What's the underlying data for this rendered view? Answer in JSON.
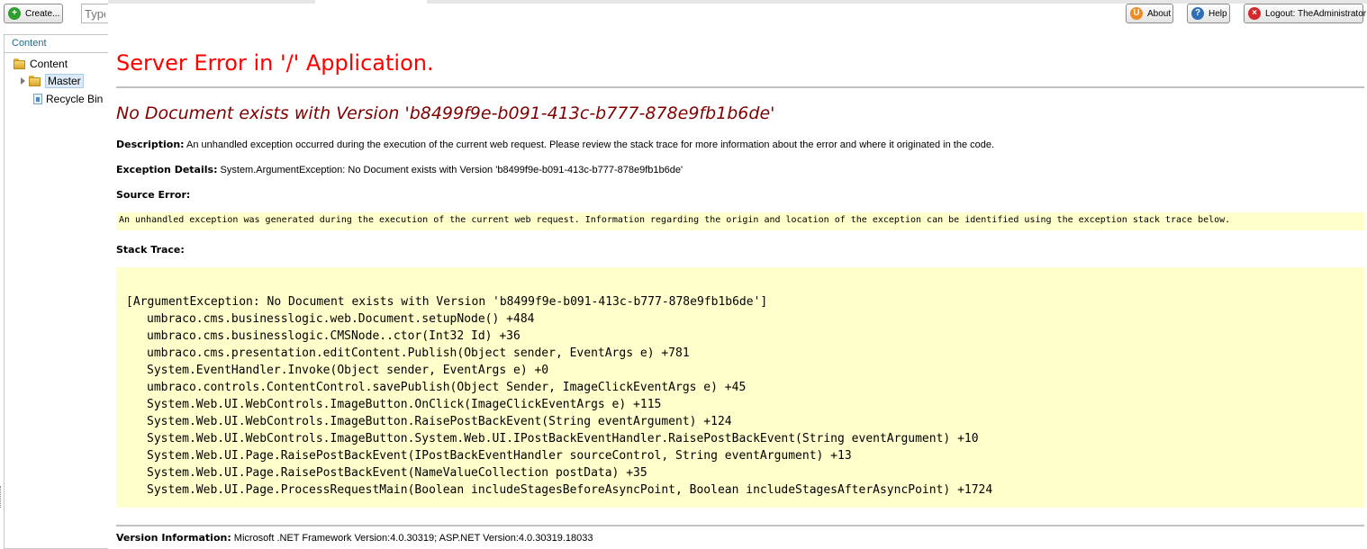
{
  "toolbar": {
    "create_label": "Create...",
    "search_placeholder": "Type",
    "about_label": "About",
    "help_label": "Help",
    "logout_label": "Logout: TheAdministrator"
  },
  "tree": {
    "tab_label": "Content",
    "root": "Content",
    "items": [
      {
        "label": "Master"
      },
      {
        "label": "Recycle Bin"
      }
    ]
  },
  "error": {
    "title": "Server Error in '/' Application.",
    "subtitle": "No Document exists with Version 'b8499f9e-b091-413c-b777-878e9fb1b6de'",
    "description_label": "Description:",
    "description_text": "An unhandled exception occurred during the execution of the current web request. Please review the stack trace for more information about the error and where it originated in the code.",
    "exception_label": "Exception Details:",
    "exception_text": "System.ArgumentException: No Document exists with Version 'b8499f9e-b091-413c-b777-878e9fb1b6de'",
    "source_error_label": "Source Error:",
    "source_error_text": "An unhandled exception was generated during the execution of the current web request. Information regarding the origin and location of the exception can be identified using the exception stack trace below.",
    "stack_trace_label": "Stack Trace:",
    "stack_header": "[ArgumentException: No Document exists with Version 'b8499f9e-b091-413c-b777-878e9fb1b6de']",
    "stack_lines": [
      "umbraco.cms.businesslogic.web.Document.setupNode() +484",
      "umbraco.cms.businesslogic.CMSNode..ctor(Int32 Id) +36",
      "umbraco.cms.presentation.editContent.Publish(Object sender, EventArgs e) +781",
      "System.EventHandler.Invoke(Object sender, EventArgs e) +0",
      "umbraco.controls.ContentControl.savePublish(Object Sender, ImageClickEventArgs e) +45",
      "System.Web.UI.WebControls.ImageButton.OnClick(ImageClickEventArgs e) +115",
      "System.Web.UI.WebControls.ImageButton.RaisePostBackEvent(String eventArgument) +124",
      "System.Web.UI.WebControls.ImageButton.System.Web.UI.IPostBackEventHandler.RaisePostBackEvent(String eventArgument) +10",
      "System.Web.UI.Page.RaisePostBackEvent(IPostBackEventHandler sourceControl, String eventArgument) +13",
      "System.Web.UI.Page.RaisePostBackEvent(NameValueCollection postData) +35",
      "System.Web.UI.Page.ProcessRequestMain(Boolean includeStagesBeforeAsyncPoint, Boolean includeStagesAfterAsyncPoint) +1724"
    ],
    "version_label": "Version Information:",
    "version_text": "Microsoft .NET Framework Version:4.0.30319; ASP.NET Version:4.0.30319.18033"
  },
  "colors": {
    "title_red": "#ff0000",
    "subtitle_maroon": "#800000",
    "code_bg": "#ffffcc",
    "accent_blue": "#1d6a8e"
  },
  "icons": {
    "create": "plus-circle-icon",
    "about": "umbraco-logo-icon",
    "help": "question-icon",
    "logout": "close-circle-icon"
  }
}
